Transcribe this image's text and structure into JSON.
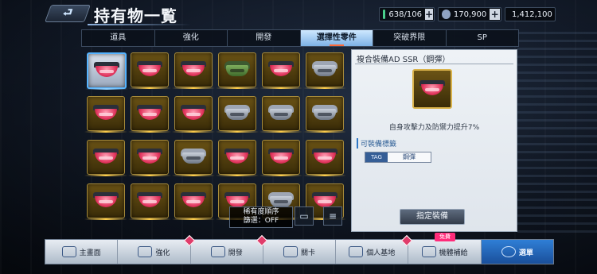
{
  "header": {
    "back_label": "⮐",
    "title": "持有物一覧",
    "resources": [
      {
        "name": "capacity",
        "value": "638/106",
        "icon": "box-icon",
        "color": "#4ad08c",
        "has_plus": true
      },
      {
        "name": "credits",
        "value": "170,900",
        "icon": "credit-icon",
        "color": "#8fa3c2",
        "has_plus": true
      },
      {
        "name": "gold",
        "value": "1,412,100",
        "icon": "coin-icon",
        "color": "#e6b43a",
        "has_plus": false
      }
    ]
  },
  "tabs": [
    {
      "label": "道具",
      "active": false
    },
    {
      "label": "強化",
      "active": false
    },
    {
      "label": "開發",
      "active": false
    },
    {
      "label": "選擇性零件",
      "active": true
    },
    {
      "label": "突破界限",
      "active": false
    },
    {
      "label": "SP",
      "active": false
    }
  ],
  "grid": {
    "rows": [
      [
        "mouth",
        "mouth",
        "mouth",
        "green",
        "mouth",
        "armor"
      ],
      [
        "mouth",
        "mouth",
        "mouth",
        "armor",
        "armor",
        "armor"
      ],
      [
        "mouth",
        "mouth",
        "armor",
        "mouth",
        "mouth",
        "mouth"
      ],
      [
        "mouth",
        "mouth",
        "mouth",
        "mouth",
        "armor",
        "mouth"
      ]
    ],
    "selected": [
      0,
      0
    ]
  },
  "sort": {
    "order_label": "稀有度順序",
    "filter_label": "篩選：OFF"
  },
  "detail": {
    "name": "複合裝備AD SSR（鋼彈）",
    "effect": "自身攻擊力及防禦力提升7%",
    "tag_heading": "可裝備標籤",
    "tag_key": "TAG",
    "tag_value": "鋼彈",
    "equip_label": "指定裝備"
  },
  "nav": [
    {
      "label": "主畫面",
      "icon": "home-icon",
      "alert": false
    },
    {
      "label": "強化",
      "icon": "wrench-icon",
      "alert": true
    },
    {
      "label": "開發",
      "icon": "develop-icon",
      "alert": true
    },
    {
      "label": "關卡",
      "icon": "rifle-icon",
      "alert": false
    },
    {
      "label": "個人基地",
      "icon": "base-icon",
      "alert": true
    },
    {
      "label": "機體補給",
      "icon": "supply-icon",
      "alert": false
    },
    {
      "label": "選單",
      "icon": "menu-icon",
      "alert": false
    }
  ],
  "free_badge": "免費"
}
